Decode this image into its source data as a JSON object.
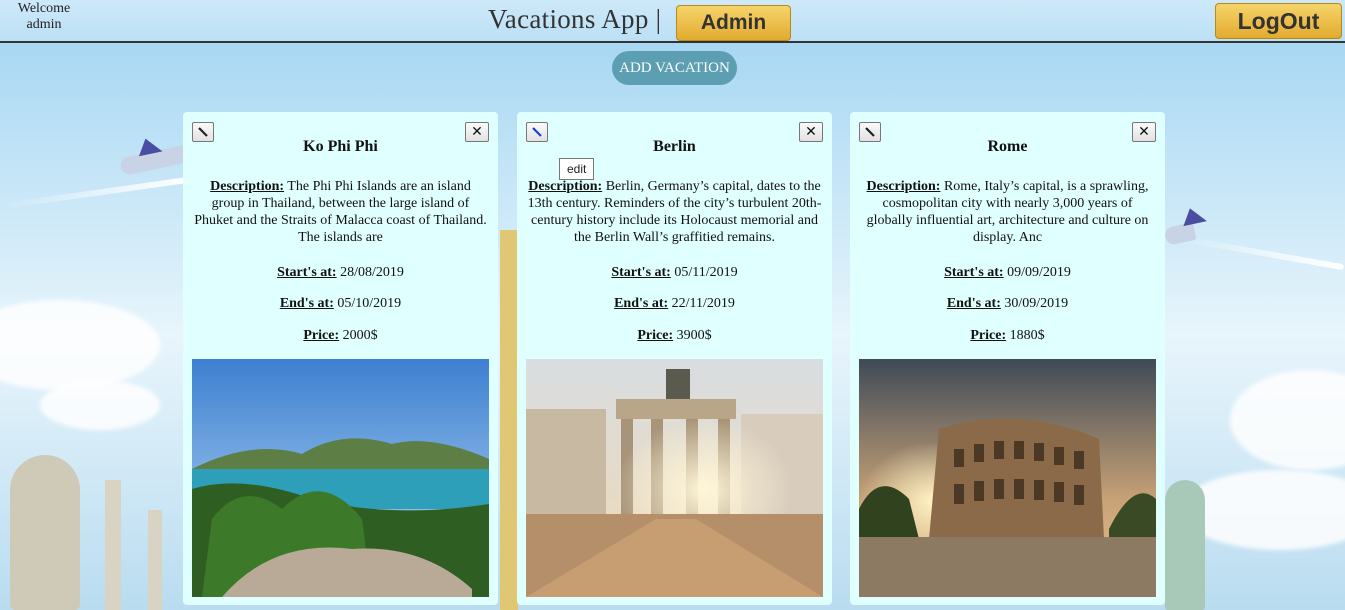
{
  "header": {
    "welcome_line1": "Welcome",
    "welcome_line2": "admin",
    "app_title": "Vacations App |",
    "admin_label": "Admin",
    "logout_label": "LogOut"
  },
  "add_vacation_label": "ADD VACATION",
  "tooltip_text": "edit",
  "labels": {
    "description": "Description:",
    "start": "Start's at:",
    "end": "End's at:",
    "price": "Price:"
  },
  "delete_symbol": "✕",
  "vacations": [
    {
      "title": "Ko Phi Phi",
      "description": "The Phi Phi Islands are an island group in Thailand, between the large island of Phuket and the Straits of Malacca coast of Thailand. The islands are",
      "start": "28/08/2019",
      "end": "05/10/2019",
      "price": "2000$",
      "photo_icon": "island-beach-photo"
    },
    {
      "title": "Berlin",
      "description": "Berlin, Germany’s capital, dates to the 13th century. Reminders of the city’s turbulent 20th-century history include its Holocaust memorial and the Berlin Wall’s graffitied remains.",
      "start": "05/11/2019",
      "end": "22/11/2019",
      "price": "3900$",
      "photo_icon": "brandenburg-gate-photo"
    },
    {
      "title": "Rome",
      "description": "Rome, Italy’s capital, is a sprawling, cosmopolitan city with nearly 3,000 years of globally influential art, architecture and culture on display. Anc",
      "start": "09/09/2019",
      "end": "30/09/2019",
      "price": "1880$",
      "photo_icon": "colosseum-photo"
    }
  ],
  "colors": {
    "card_background": "#e0ffff",
    "gold_button": "#e2ab2f",
    "add_button": "#5c9fb2"
  }
}
